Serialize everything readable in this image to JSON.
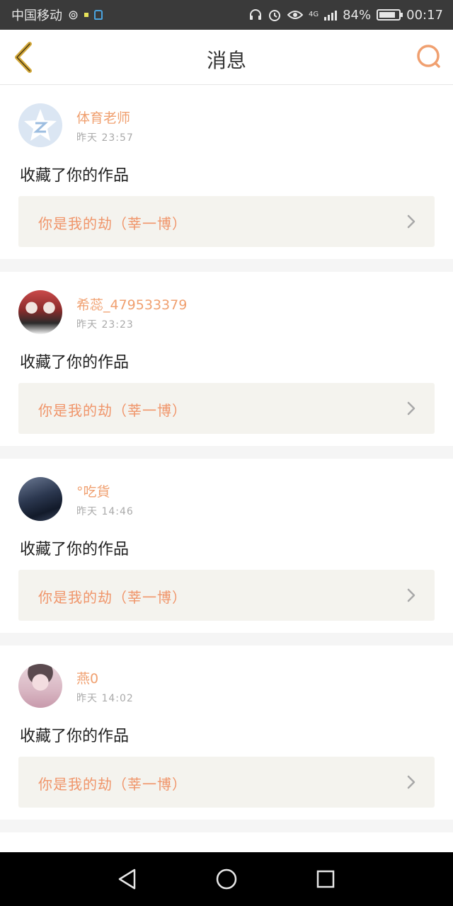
{
  "status_bar": {
    "carrier": "中国移动",
    "battery": "84%",
    "time": "00:17",
    "network": "4G"
  },
  "header": {
    "title": "消息"
  },
  "notifications": [
    {
      "username": "体育老师",
      "time": "昨天 23:57",
      "action": "收藏了你的作品",
      "work_title": "你是我的劫（莘一博）"
    },
    {
      "username": "希蕊_479533379",
      "time": "昨天 23:23",
      "action": "收藏了你的作品",
      "work_title": "你是我的劫（莘一博）"
    },
    {
      "username": "°吃貨",
      "time": "昨天 14:46",
      "action": "收藏了你的作品",
      "work_title": "你是我的劫（莘一博）"
    },
    {
      "username": "燕0",
      "time": "昨天 14:02",
      "action": "收藏了你的作品",
      "work_title": "你是我的劫（莘一博）"
    }
  ],
  "colors": {
    "accent": "#f0a070",
    "back_icon": "#d4a93b",
    "link_text": "#f0956a"
  },
  "icons": {
    "back": "chevron-left-icon",
    "search": "search-icon",
    "chevron": "chevron-right-icon",
    "nav_back": "triangle-back-icon",
    "nav_home": "circle-home-icon",
    "nav_recents": "square-recents-icon"
  }
}
